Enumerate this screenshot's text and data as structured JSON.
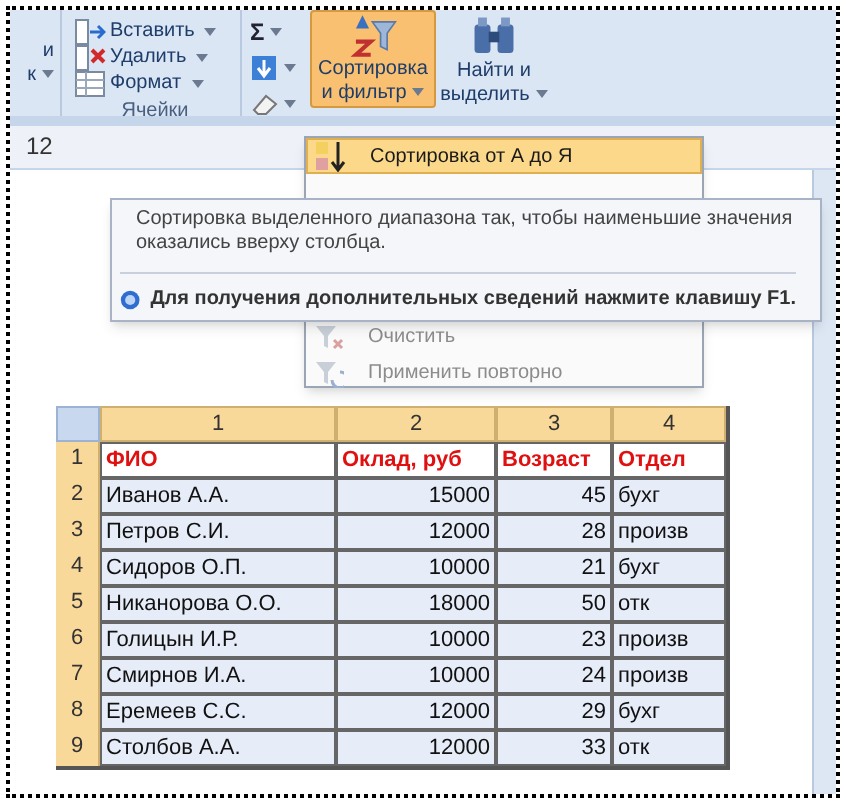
{
  "ribbon": {
    "partial_group": {
      "lines": [
        "и",
        "к"
      ]
    },
    "cells_group": {
      "title": "Ячейки",
      "buttons": [
        {
          "kind": "insert",
          "label": "Вставить"
        },
        {
          "kind": "delete",
          "label": "Удалить"
        },
        {
          "kind": "format",
          "label": "Формат"
        }
      ]
    },
    "editing_group": {
      "sum_symbol": "Σ",
      "sort_button": {
        "label_lines": [
          "Сортировка",
          "и фильтр"
        ],
        "selected": true
      },
      "find_button": {
        "label_lines": [
          "Найти и",
          "выделить"
        ],
        "selected": false
      }
    }
  },
  "name_box": {
    "value": "12"
  },
  "sort_menu": {
    "items": [
      {
        "kind": "sort",
        "label": "Сортировка от А до Я",
        "highlighted": true,
        "disabled": false
      },
      {
        "kind": "clear",
        "label": "Очистить",
        "highlighted": false,
        "disabled": true
      },
      {
        "kind": "reapply",
        "label": "Применить повторно",
        "highlighted": false,
        "disabled": true
      }
    ]
  },
  "tooltip": {
    "description": "Сортировка выделенного диапазона так, чтобы наименьшие значения оказались вверху столбца.",
    "help": "Для получения дополнительных сведений нажмите клавишу F1."
  },
  "sheet": {
    "columns": [
      {
        "label": "1",
        "selected": true
      },
      {
        "label": "2",
        "selected": true
      },
      {
        "label": "3",
        "selected": true
      },
      {
        "label": "4",
        "selected": true
      }
    ],
    "rows": [
      {
        "number": "1",
        "selected": true,
        "kind": "header",
        "cells": [
          "ФИО",
          "Оклад, руб",
          "Возраст",
          "Отдел"
        ]
      },
      {
        "number": "2",
        "selected": true,
        "kind": "data",
        "cells": [
          "Иванов А.А.",
          "15000",
          "45",
          "бухг"
        ]
      },
      {
        "number": "3",
        "selected": true,
        "kind": "data",
        "cells": [
          "Петров С.И.",
          "12000",
          "28",
          "произв"
        ]
      },
      {
        "number": "4",
        "selected": true,
        "kind": "data",
        "cells": [
          "Сидоров О.П.",
          "10000",
          "21",
          "бухг"
        ]
      },
      {
        "number": "5",
        "selected": true,
        "kind": "data",
        "cells": [
          "Никанорова О.О.",
          "18000",
          "50",
          "отк"
        ]
      },
      {
        "number": "6",
        "selected": true,
        "kind": "data",
        "cells": [
          "Голицын И.Р.",
          "10000",
          "23",
          "произв"
        ]
      },
      {
        "number": "7",
        "selected": true,
        "kind": "data",
        "cells": [
          "Смирнов И.А.",
          "10000",
          "24",
          "произв"
        ]
      },
      {
        "number": "8",
        "selected": true,
        "kind": "data",
        "cells": [
          "Еремеев С.С.",
          "12000",
          "29",
          "бухг"
        ]
      },
      {
        "number": "9",
        "selected": true,
        "kind": "data",
        "cells": [
          "Столбов А.А.",
          "12000",
          "33",
          "отк"
        ]
      }
    ]
  }
}
